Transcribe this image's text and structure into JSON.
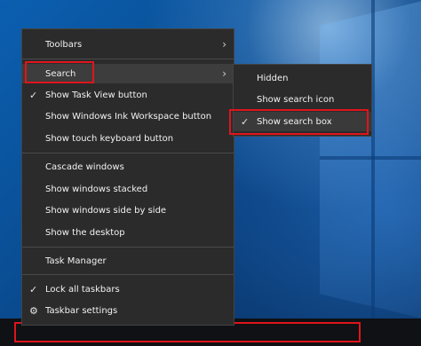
{
  "context_menu": {
    "items": [
      {
        "label": "Toolbars",
        "has_submenu": true
      },
      {
        "label": "Search",
        "has_submenu": true
      },
      {
        "label": "Show Task View button",
        "checked": true
      },
      {
        "label": "Show Windows Ink Workspace button"
      },
      {
        "label": "Show touch keyboard button"
      },
      {
        "label": "Cascade windows"
      },
      {
        "label": "Show windows stacked"
      },
      {
        "label": "Show windows side by side"
      },
      {
        "label": "Show the desktop"
      },
      {
        "label": "Task Manager"
      },
      {
        "label": "Lock all taskbars",
        "checked": true
      },
      {
        "label": "Taskbar settings",
        "icon": "gear-icon"
      }
    ]
  },
  "search_submenu": {
    "items": [
      {
        "label": "Hidden"
      },
      {
        "label": "Show search icon"
      },
      {
        "label": "Show search box",
        "checked": true
      }
    ]
  },
  "colors": {
    "highlight": "#e0141b",
    "menu_bg": "#2b2b2b",
    "taskbar_bg": "#0f1114"
  },
  "glyphs": {
    "check": "✓",
    "arrow": "›",
    "gear": "⚙"
  }
}
